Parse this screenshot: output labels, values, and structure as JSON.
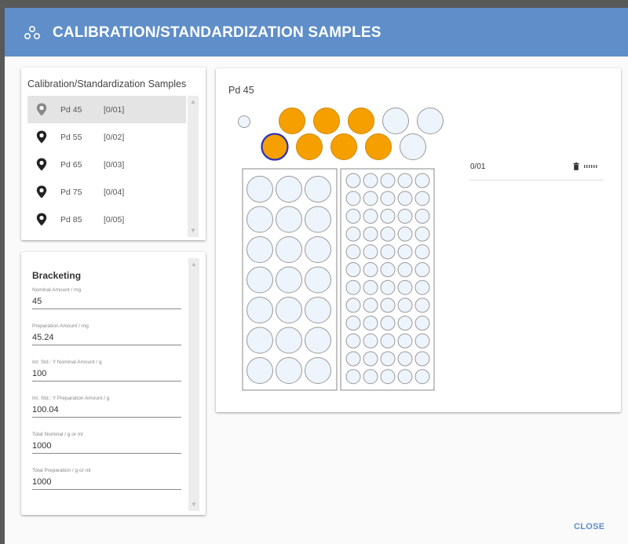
{
  "dialog": {
    "title": "CALIBRATION/STANDARDIZATION SAMPLES",
    "title_icon": "sample-molecule-icon",
    "close_label": "CLOSE",
    "accent_color": "#5f8ec9"
  },
  "samples_panel": {
    "title": "Calibration/Standardization Samples",
    "items": [
      {
        "name": "Pd 45",
        "position": "[0/01]",
        "selected": true
      },
      {
        "name": "Pd 55",
        "position": "[0/02]",
        "selected": false
      },
      {
        "name": "Pd 65",
        "position": "[0/03]",
        "selected": false
      },
      {
        "name": "Pd 75",
        "position": "[0/04]",
        "selected": false
      },
      {
        "name": "Pd 85",
        "position": "[0/05]",
        "selected": false
      }
    ]
  },
  "bracketing": {
    "title": "Bracketing",
    "fields": [
      {
        "label": "Nominal Amount / mg",
        "value": "45"
      },
      {
        "label": "Preparation Amount / mg",
        "value": "45.24"
      },
      {
        "label": "Int. Std.: Y Nominal Amount / g",
        "value": "100"
      },
      {
        "label": "Int. Std.: Y Preparation Amount / g",
        "value": "100.04"
      },
      {
        "label": "Total Nominal / g or ml",
        "value": "1000"
      },
      {
        "label": "Total Preparation / g or ml",
        "value": "1000"
      }
    ]
  },
  "plate_panel": {
    "title": "Pd 45",
    "selected_position": "0/01",
    "icons": {
      "delete": "trash-icon",
      "reorder": "drag-handle-icon"
    },
    "colors": {
      "filled": "#f5a000",
      "empty": "#eef4fc",
      "selected_outline": "#2a2fb8",
      "well_outline": "#999999"
    },
    "top_rows": {
      "row1_filled": [
        true,
        true,
        true,
        false,
        false
      ],
      "row2_filled": [
        true,
        true,
        true,
        true,
        false
      ],
      "row2_selected_index": 0
    },
    "large_rack": {
      "rows": 7,
      "cols": 3
    },
    "small_rack": {
      "rows": 12,
      "cols": 5
    }
  }
}
